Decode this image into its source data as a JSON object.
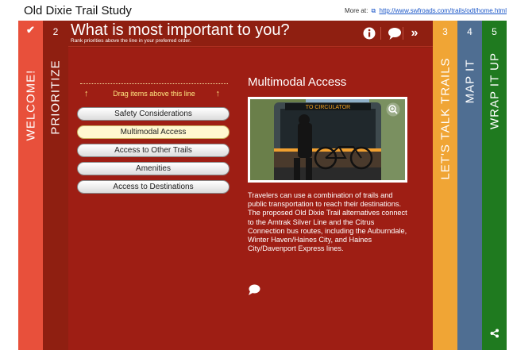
{
  "app": {
    "title": "Old Dixie Trail Study",
    "more_at_label": "More at:",
    "more_link": "http://www.swfroads.com/trails/odt/home.html"
  },
  "tabs": {
    "welcome": {
      "label": "WELCOME!",
      "color": "#e8503b"
    },
    "prioritize": {
      "number": "2",
      "label": "PRIORITIZE",
      "color": "#8f1f11"
    },
    "talk": {
      "number": "3",
      "label": "LET'S TALK TRAILS",
      "color": "#f0a535"
    },
    "map": {
      "number": "4",
      "label": "MAP IT",
      "color": "#4f6e92"
    },
    "wrap": {
      "number": "5",
      "label": "WRAP IT UP",
      "color": "#1f7a1f"
    }
  },
  "header": {
    "title": "What is most important to you?",
    "subtitle": "Rank priorities above the line in your preferred order."
  },
  "priorities": {
    "hint": "Drag items above this line",
    "items": [
      {
        "label": "Safety Considerations"
      },
      {
        "label": "Multimodal Access"
      },
      {
        "label": "Access to Other Trails"
      },
      {
        "label": "Amenities"
      },
      {
        "label": "Access to Destinations"
      }
    ],
    "selected": "Multimodal Access"
  },
  "detail": {
    "title": "Multimodal Access",
    "bus_sign": "TO CIRCULATOR",
    "description": "Travelers can use a combination of trails and public transportation to reach their destinations. The proposed Old Dixie Trail alternatives connect to the Amtrak Silver Line and the Citrus Connection bus routes, including the Auburndale, Winter Haven/Haines City, and Haines City/Davenport Express lines."
  },
  "icons": {
    "check": "check-icon",
    "info": "info-icon",
    "comment": "comment-icon",
    "forward": "double-chevron-right-icon",
    "zoom": "zoom-in-icon",
    "share": "share-icon",
    "external": "external-link-icon"
  }
}
